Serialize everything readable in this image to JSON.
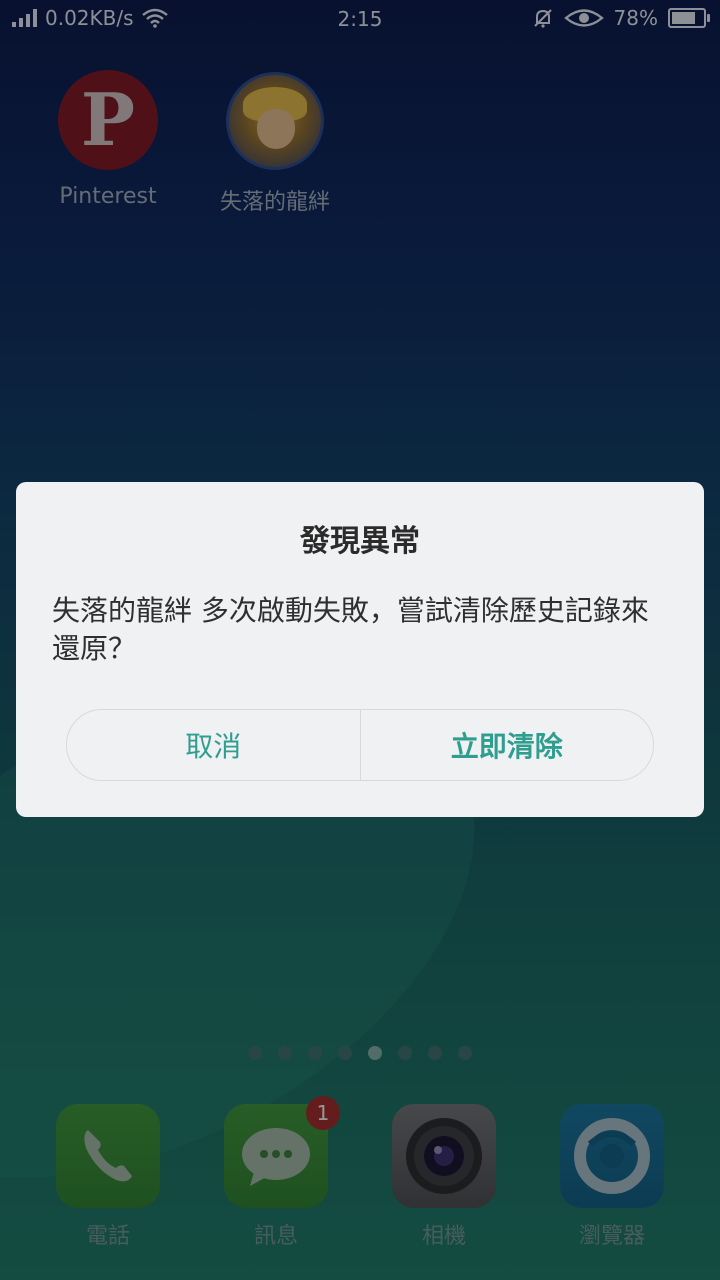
{
  "status_bar": {
    "speed": "0.02KB/s",
    "time": "2:15",
    "battery_percent": "78%",
    "battery_level": 0.78
  },
  "home_apps": [
    {
      "label": "Pinterest",
      "icon": "pinterest-icon"
    },
    {
      "label": "失落的龍絆",
      "icon": "game-icon"
    }
  ],
  "dialog": {
    "title": "發現異常",
    "message": "失落的龍絆 多次啟動失敗，嘗試清除歷史記錄來還原？",
    "cancel_label": "取消",
    "confirm_label": "立即清除",
    "accent_color": "#2f9e8f"
  },
  "page_indicator": {
    "count": 8,
    "active_index": 4
  },
  "dock": [
    {
      "label": "電話",
      "icon": "phone-icon"
    },
    {
      "label": "訊息",
      "icon": "message-icon",
      "badge": "1"
    },
    {
      "label": "相機",
      "icon": "camera-icon"
    },
    {
      "label": "瀏覽器",
      "icon": "browser-icon"
    }
  ]
}
